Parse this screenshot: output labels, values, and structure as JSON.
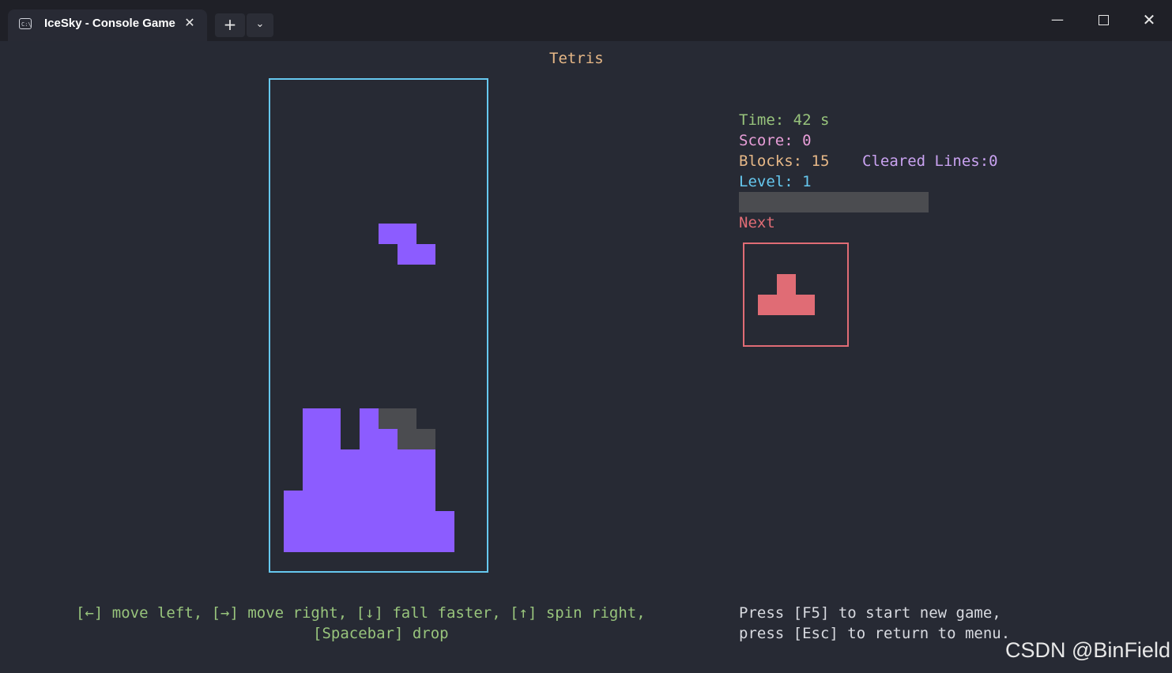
{
  "window": {
    "tab_title": "IceSky - Console Game",
    "tab_icon": "terminal-icon",
    "tab_close_glyph": "✕",
    "new_tab_glyph": "+",
    "dropdown_glyph": "⌄",
    "minimize_glyph": "—",
    "close_glyph": "✕"
  },
  "game": {
    "title": "Tetris",
    "time_text": "Time: 42 s",
    "score_text": "Score: 0",
    "blocks_text": "Blocks: 15",
    "cleared_text": "Cleared Lines:0",
    "level_text": "Level: 1",
    "level_progress": 0.0,
    "next_label": "Next",
    "board": {
      "columns": 11,
      "rows": 24,
      "falling_piece": {
        "type": "Z",
        "color": "#8c5cff",
        "cells": [
          [
            5,
            7
          ],
          [
            6,
            7
          ],
          [
            6,
            8
          ],
          [
            7,
            8
          ]
        ]
      },
      "settled_cells_purple": [
        [
          1,
          16
        ],
        [
          2,
          16
        ],
        [
          4,
          16
        ],
        [
          1,
          17
        ],
        [
          2,
          17
        ],
        [
          4,
          17
        ],
        [
          5,
          17
        ],
        [
          1,
          18
        ],
        [
          2,
          18
        ],
        [
          3,
          18
        ],
        [
          4,
          18
        ],
        [
          5,
          18
        ],
        [
          6,
          18
        ],
        [
          7,
          18
        ],
        [
          1,
          19
        ],
        [
          2,
          19
        ],
        [
          3,
          19
        ],
        [
          4,
          19
        ],
        [
          5,
          19
        ],
        [
          6,
          19
        ],
        [
          7,
          19
        ],
        [
          0,
          20
        ],
        [
          1,
          20
        ],
        [
          2,
          20
        ],
        [
          3,
          20
        ],
        [
          4,
          20
        ],
        [
          5,
          20
        ],
        [
          6,
          20
        ],
        [
          7,
          20
        ],
        [
          0,
          21
        ],
        [
          1,
          21
        ],
        [
          2,
          21
        ],
        [
          3,
          21
        ],
        [
          4,
          21
        ],
        [
          5,
          21
        ],
        [
          6,
          21
        ],
        [
          7,
          21
        ],
        [
          8,
          21
        ],
        [
          0,
          22
        ],
        [
          1,
          22
        ],
        [
          2,
          22
        ],
        [
          3,
          22
        ],
        [
          4,
          22
        ],
        [
          5,
          22
        ],
        [
          6,
          22
        ],
        [
          7,
          22
        ],
        [
          8,
          22
        ]
      ],
      "ghost_cells": [
        [
          5,
          16
        ],
        [
          6,
          16
        ],
        [
          6,
          17
        ],
        [
          7,
          17
        ]
      ],
      "piece_color": "#8c5cff",
      "ghost_color": "#4b4c50"
    },
    "next_piece": {
      "type": "T",
      "color": "#e06c75",
      "cells": [
        [
          1,
          0
        ],
        [
          0,
          1
        ],
        [
          1,
          1
        ],
        [
          2,
          1
        ]
      ]
    },
    "help_line1": "[←] move left, [→] move right, [↓] fall faster, [↑] spin right,",
    "help_line2": "[Spacebar] drop",
    "press_line1": "Press [F5] to start new game,",
    "press_line2": "press [Esc] to return to menu."
  },
  "watermark": "CSDN @BinField",
  "colors": {
    "background": "#272a34",
    "field_border": "#66c8ef",
    "next_border": "#e06c75"
  }
}
